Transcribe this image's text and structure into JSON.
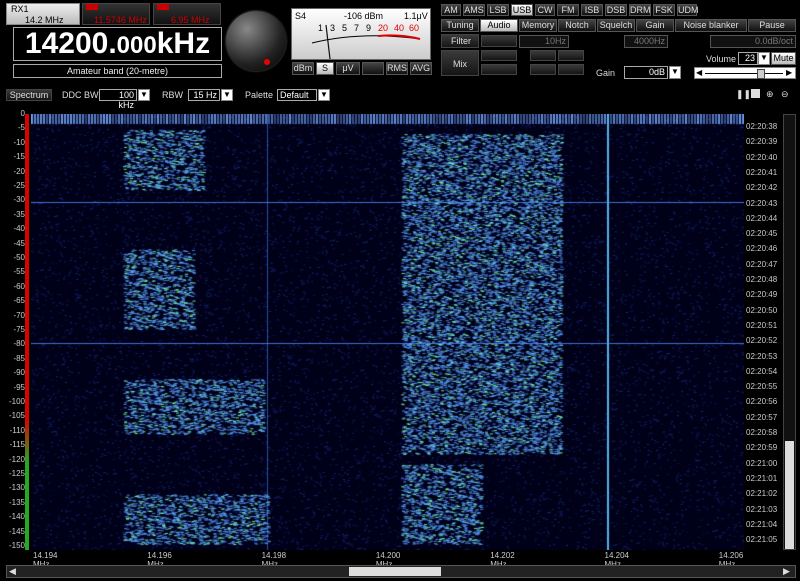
{
  "rx": {
    "name": "RX1",
    "freq": "14.2 MHz"
  },
  "vfo_b": {
    "freq": "11.5746 MHz"
  },
  "vfo_c": {
    "freq": "6.95 MHz"
  },
  "frequency": {
    "main": "14200.",
    "fraction": "000",
    "unit": "kHz"
  },
  "band_label": "Amateur band (20-metre)",
  "meter": {
    "name": "S4",
    "dbm": "-106 dBm",
    "uv": "1.1μV",
    "scale": [
      "1",
      "3",
      "5",
      "7",
      "9",
      "20",
      "40",
      "60"
    ],
    "buttons": [
      "dBm",
      "S",
      "μV",
      "RMS",
      "AVG"
    ],
    "selected": "S"
  },
  "modes": [
    "AM",
    "AMS",
    "LSB",
    "USB",
    "CW",
    "FM",
    "ISB",
    "DSB",
    "DRM",
    "FSK",
    "UDM"
  ],
  "mode_selected": "USB",
  "tabs": [
    "Tuning",
    "Audio",
    "Memory",
    "Notch",
    "Squelch",
    "Gain",
    "Noise blanker",
    "Pause"
  ],
  "tab_selected": "Audio",
  "audio": {
    "filter_label": "Filter",
    "mix_label": "Mix",
    "low": "10Hz",
    "high": "4000Hz",
    "slope": "0.0dB/oct",
    "gain_label": "Gain",
    "gain": "0dB",
    "volume_label": "Volume",
    "volume": "23",
    "mute_label": "Mute"
  },
  "toolbar": {
    "spectrum_label": "Spectrum",
    "ddc_bw_label": "DDC BW",
    "ddc_bw": "100 kHz",
    "rbw_label": "RBW",
    "rbw": "15 Hz",
    "palette_label": "Palette",
    "palette": "Default"
  },
  "waterfall": {
    "y_ticks": [
      "0",
      "-5",
      "-10",
      "-15",
      "-20",
      "-25",
      "-30",
      "-35",
      "-40",
      "-45",
      "-50",
      "-55",
      "-60",
      "-65",
      "-70",
      "-75",
      "-80",
      "-85",
      "-90",
      "-95",
      "-100",
      "-105",
      "-110",
      "-115",
      "-120",
      "-125",
      "-130",
      "-135",
      "-140",
      "-145",
      "-150"
    ],
    "times": [
      "02:20:38",
      "02:20:39",
      "02:20:40",
      "02:20:41",
      "02:20:42",
      "02:20:43",
      "02:20:44",
      "02:20:45",
      "02:20:46",
      "02:20:47",
      "02:20:48",
      "02:20:49",
      "02:20:50",
      "02:20:51",
      "02:20:52",
      "02:20:53",
      "02:20:54",
      "02:20:55",
      "02:20:56",
      "02:20:57",
      "02:20:58",
      "02:20:59",
      "02:21:00",
      "02:21:01",
      "02:21:02",
      "02:21:03",
      "02:21:04",
      "02:21:05"
    ],
    "x_ticks": [
      "14.194 MHz",
      "14.196 MHz",
      "14.198 MHz",
      "14.200 MHz",
      "14.202 MHz",
      "14.204 MHz",
      "14.206 MHz"
    ]
  },
  "colors": {
    "accent": "#cc0000",
    "waterfall_bg": "#000018",
    "signal": "#3a8cff"
  }
}
